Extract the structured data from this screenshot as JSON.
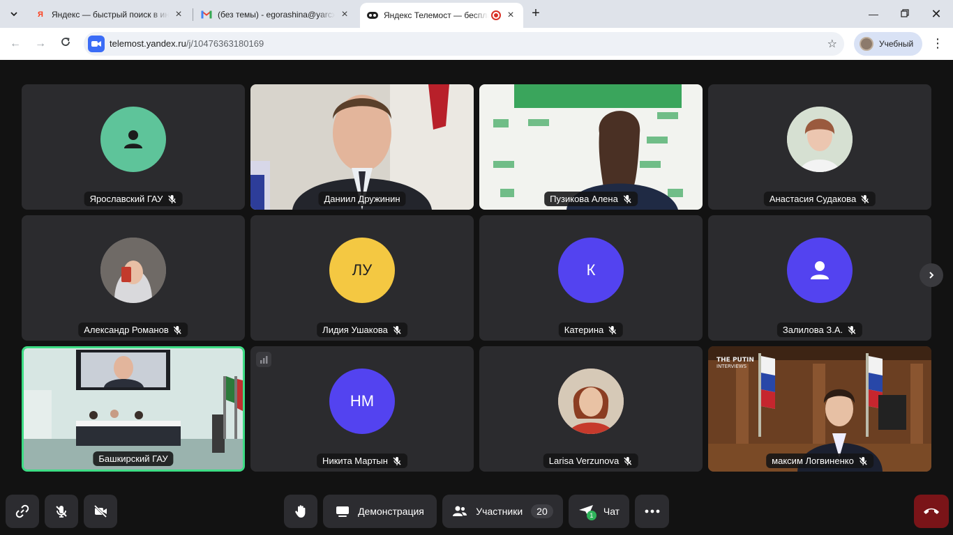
{
  "browser": {
    "tabs": [
      {
        "title": "Яндекс — быстрый поиск в интернете",
        "favicon": "yandex-icon"
      },
      {
        "title": "(без темы) - egorashina@yarcx",
        "favicon": "gmail-icon"
      },
      {
        "title": "Яндекс Телемост — бесплатные",
        "favicon": "telemost-icon",
        "active": true
      }
    ],
    "url_host": "telemost.yandex.ru",
    "url_path": "/j/10476363180169",
    "profile_name": "Учебный"
  },
  "participants": [
    {
      "name": "Ярославский ГАУ",
      "avatar": "person-icon",
      "avatar_color": "#5ec49a",
      "mic": "off",
      "video": false
    },
    {
      "name": "Даниил Дружинин",
      "mic": "on",
      "video": true
    },
    {
      "name": "Пузикова Алена",
      "mic": "off",
      "video": true
    },
    {
      "name": "Анастасия Судакова",
      "mic": "off",
      "video": false,
      "photo": true
    },
    {
      "name": "Александр Романов",
      "mic": "off",
      "video": false,
      "photo": true
    },
    {
      "name": "Лидия Ушакова",
      "initials": "ЛУ",
      "avatar_color": "#f4c842",
      "initials_color": "#222222",
      "mic": "off",
      "video": false
    },
    {
      "name": "Катерина",
      "initials": "К",
      "avatar_color": "#5343f0",
      "initials_color": "#ffffff",
      "mic": "off",
      "video": false
    },
    {
      "name": "Залилова З.А.",
      "avatar": "person-icon",
      "avatar_color": "#5343f0",
      "mic": "off",
      "video": false
    },
    {
      "name": "Башкирский ГАУ",
      "mic": "on",
      "video": true,
      "speaking": true
    },
    {
      "name": "Никита Мартын",
      "initials": "НМ",
      "avatar_color": "#5343f0",
      "initials_color": "#ffffff",
      "mic": "off",
      "video": false
    },
    {
      "name": "Larisa Verzunova",
      "mic": "off",
      "video": false,
      "photo": true
    },
    {
      "name": "максим Логвиненко",
      "mic": "off",
      "video": true
    }
  ],
  "controls": {
    "share_label": "Демонстрация",
    "participants_label": "Участники",
    "participants_count": "20",
    "chat_label": "Чат",
    "chat_badge": "1"
  },
  "colors": {
    "background": "#121212",
    "tile": "#2b2b2e",
    "speaking_border": "#3ddc84",
    "hangup": "#7a1418"
  }
}
